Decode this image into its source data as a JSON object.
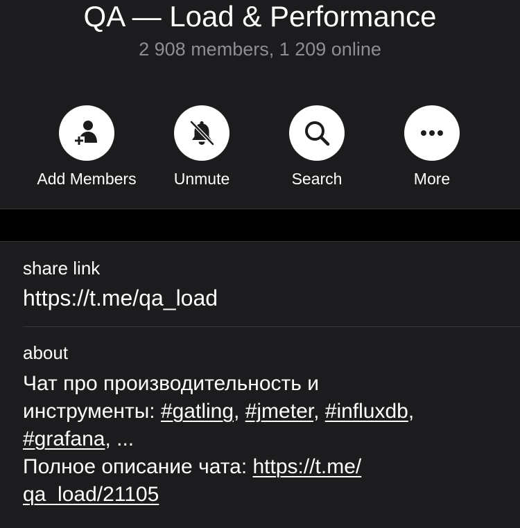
{
  "header": {
    "title": "QA — Load & Performance",
    "subtitle": "2 908 members, 1 209 online"
  },
  "actions": [
    {
      "label": "Add Members",
      "icon": "add-member-icon"
    },
    {
      "label": "Unmute",
      "icon": "bell-muted-icon"
    },
    {
      "label": "Search",
      "icon": "search-icon"
    },
    {
      "label": "More",
      "icon": "more-icon"
    }
  ],
  "share_link": {
    "caption": "share link",
    "value": "https://t.me/qa_load"
  },
  "about": {
    "caption": "about",
    "line1": "Чат про производительность и",
    "line2_prefix": "инструменты: ",
    "tags": [
      "#gatling",
      "#jmeter",
      "#influxdb",
      "#grafana"
    ],
    "tags_suffix": ", ...",
    "full_desc_prefix": "Полное описание чата: ",
    "full_desc_link_part1": "https://t.me/",
    "full_desc_link_part2": "qa_load/21105"
  },
  "colors": {
    "background": "#000000",
    "panel": "#1c1c1e",
    "secondary_text": "#8e8e93",
    "separator": "#38383a"
  }
}
